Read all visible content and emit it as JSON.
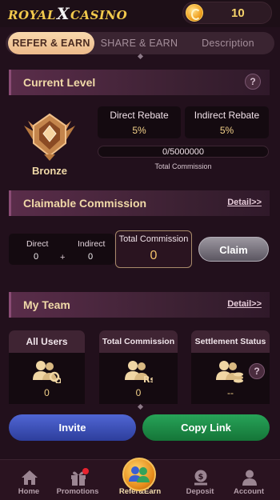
{
  "app": {
    "logo_text_left": "ROYAL",
    "logo_x": "X",
    "logo_text_right": "CASINO",
    "balance": "10"
  },
  "tabs": [
    {
      "label": "REFER & EARN",
      "active": true
    },
    {
      "label": "SHARE & EARN",
      "active": false
    },
    {
      "label": "Description",
      "active": false
    }
  ],
  "current_level": {
    "title": "Current Level",
    "help": "?",
    "level_name": "Bronze",
    "direct_rebate_label": "Direct Rebate",
    "direct_rebate_value": "5%",
    "indirect_rebate_label": "Indirect Rebate",
    "indirect_rebate_value": "5%",
    "progress_text": "0/5000000",
    "progress_fraction": 0,
    "progress_caption": "Total Commission"
  },
  "claimable": {
    "title": "Claimable Commission",
    "detail_link": "Detail>>",
    "direct_label": "Direct",
    "direct_value": "0",
    "plus": "+",
    "indirect_label": "Indirect",
    "indirect_value": "0",
    "total_label": "Total Commission",
    "total_value": "0",
    "claim_button": "Claim"
  },
  "team": {
    "title": "My Team",
    "detail_link": "Detail>>",
    "cards": [
      {
        "label": "All Users",
        "value": "0",
        "icon": "users-link-icon"
      },
      {
        "label": "Total Commission",
        "value": "0",
        "icon": "users-rupee-icon"
      },
      {
        "label": "Settlement Status",
        "value": "--",
        "icon": "users-coins-icon"
      }
    ],
    "help": "?"
  },
  "actions": {
    "invite": "Invite",
    "copy_link": "Copy Link"
  },
  "nav": [
    {
      "label": "Home",
      "icon": "home-icon"
    },
    {
      "label": "Promotions",
      "icon": "gift-icon",
      "badge": true
    },
    {
      "label": "Refer&Earn",
      "icon": "refer-earn-icon",
      "active": true
    },
    {
      "label": "Deposit",
      "icon": "deposit-icon"
    },
    {
      "label": "Account",
      "icon": "account-icon"
    }
  ],
  "colors": {
    "background": "#22101c",
    "accent_gold": "#f0d9a8",
    "active_tab": "#ecb98a",
    "invite_blue": "#3a4db8",
    "copy_green": "#1e8a4a"
  }
}
